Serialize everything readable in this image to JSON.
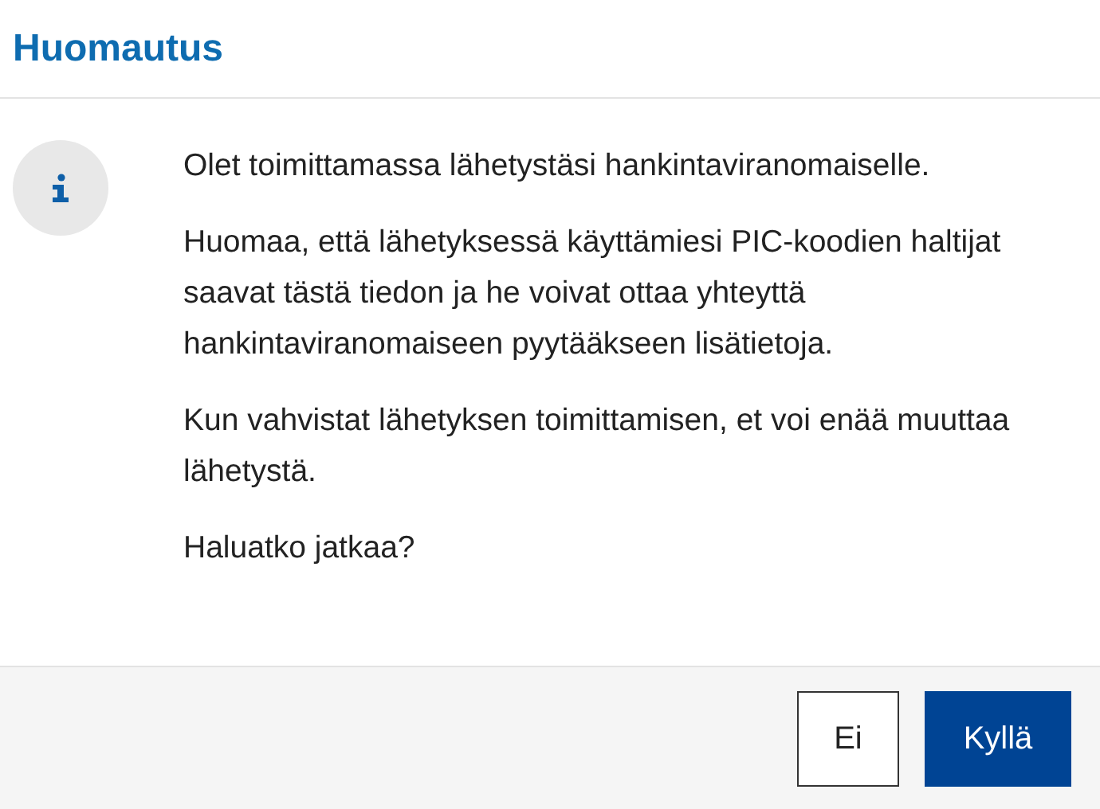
{
  "dialog": {
    "title": "Huomautus",
    "paragraphs": [
      "Olet toimittamassa lähetystäsi hankintaviranomaiselle.",
      "Huomaa, että lähetyksessä käyttämiesi PIC-koodien haltijat saavat tästä tiedon ja he voivat ottaa yhteyttä hankintaviranomaiseen pyytääkseen lisätietoja.",
      "Kun vahvistat lähetyksen toimittamisen, et voi enää muuttaa lähetystä.",
      "Haluatko jatkaa?"
    ],
    "buttons": [
      {
        "label": "Ei",
        "kind": "secondary"
      },
      {
        "label": "Kyllä",
        "kind": "primary"
      }
    ]
  }
}
